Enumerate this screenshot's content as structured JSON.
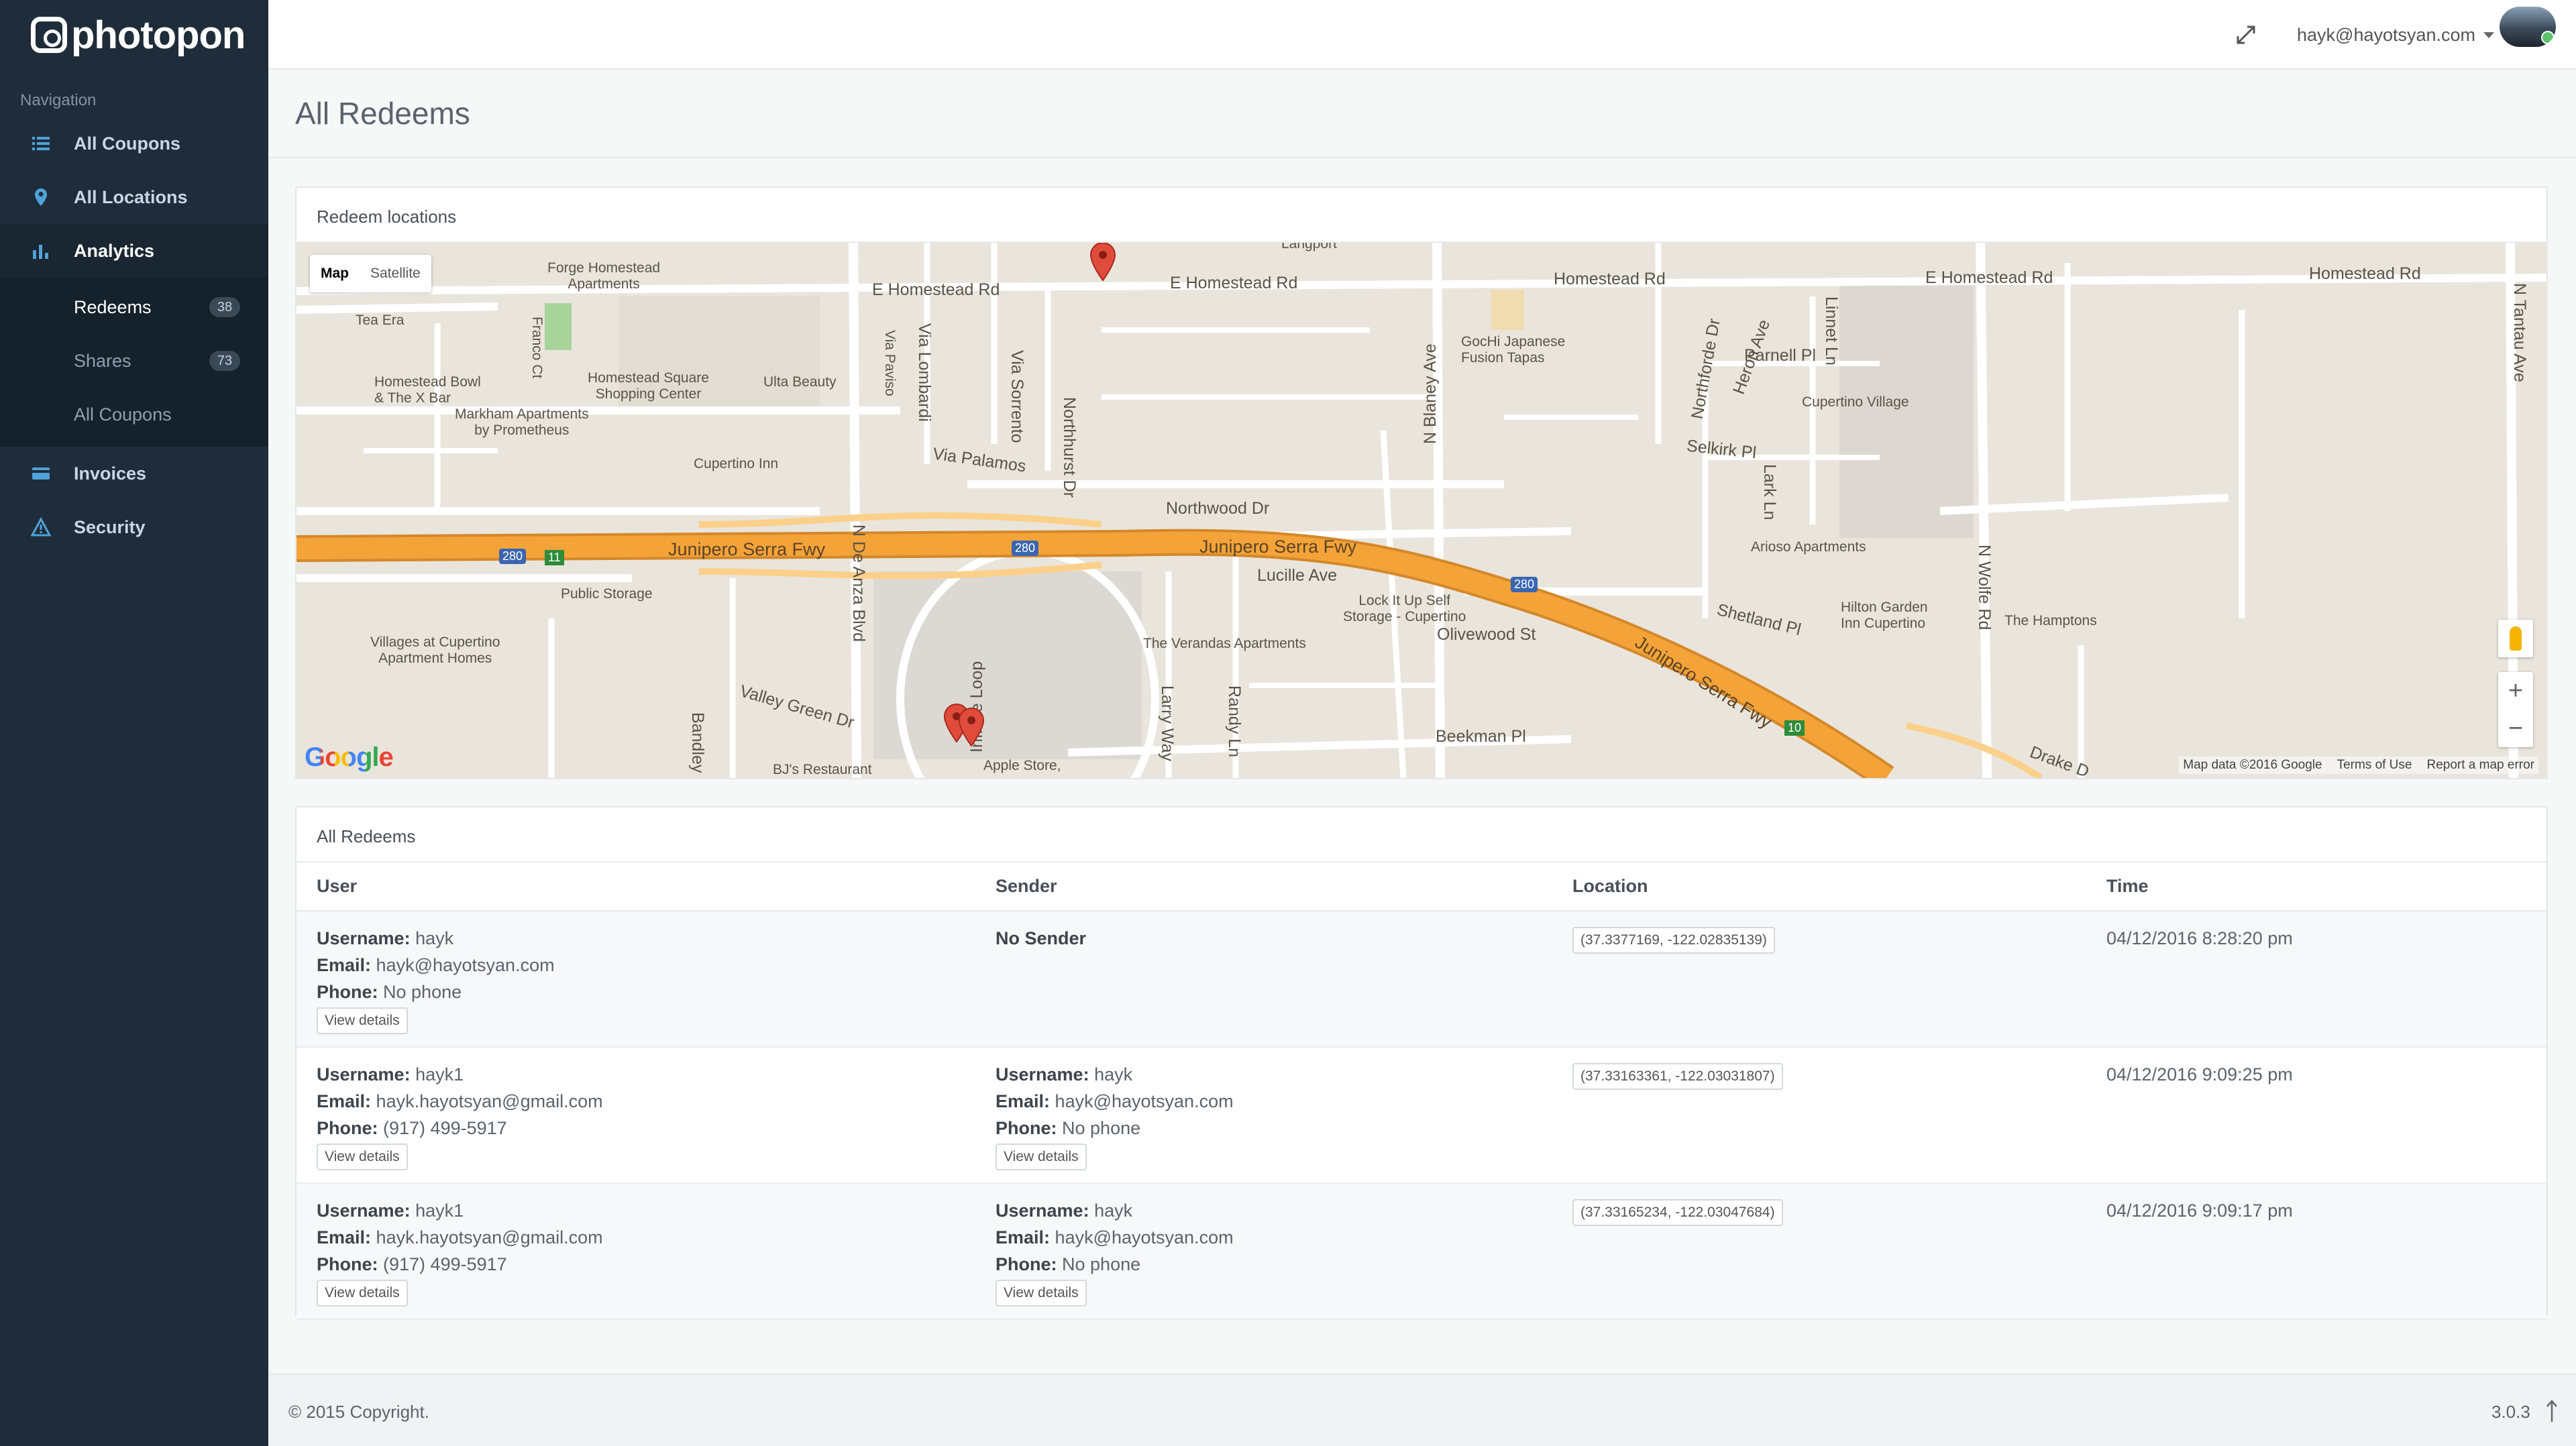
{
  "brand": {
    "name": "photopon"
  },
  "sidebar": {
    "heading": "Navigation",
    "items": [
      {
        "label": "All Coupons",
        "icon": "list-icon"
      },
      {
        "label": "All Locations",
        "icon": "map-pin-icon"
      },
      {
        "label": "Analytics",
        "icon": "bar-chart-icon",
        "active": true,
        "children": [
          {
            "label": "Redeems",
            "badge": "38",
            "active": true
          },
          {
            "label": "Shares",
            "badge": "73"
          },
          {
            "label": "All Coupons"
          }
        ]
      },
      {
        "label": "Invoices",
        "icon": "credit-card-icon"
      },
      {
        "label": "Security",
        "icon": "warning-icon"
      }
    ]
  },
  "header": {
    "user_email": "hayk@hayotsyan.com"
  },
  "page": {
    "title": "All Redeems"
  },
  "map_panel": {
    "title": "Redeem locations",
    "map_type": [
      "Map",
      "Satellite"
    ],
    "attribution": "Map data ©2016 Google",
    "terms": "Terms of Use",
    "report": "Report a map error",
    "google_logo": "Google",
    "labels": {
      "e_homestead_1": "E Homestead Rd",
      "e_homestead_2": "E Homestead Rd",
      "homestead": "Homestead Rd",
      "e_homestead_3": "E Homestead Rd",
      "homestead_4": "Homestead Rd",
      "forge": "Forge Homestead\nApartments",
      "tea_era": "Tea Era",
      "franco": "Franco Ct",
      "homestead_sq": "Homestead Square\nShopping Center",
      "ulta": "Ulta Beauty",
      "homestead_bowl": "Homestead Bowl\n& The X Bar",
      "markham": "Markham Apartments\nby Prometheus",
      "cupertino_inn": "Cupertino Inn",
      "via_palamos": "Via Palamos",
      "northwood": "Northwood Dr",
      "gochi": "GocHi Japanese\nFusion Tapas",
      "parnell": "Parnell Pl",
      "cupertino_village": "Cupertino Village",
      "selkirk": "Selkirk Pl",
      "arioso": "Arioso Apartments",
      "jsf_1": "Junipero Serra Fwy",
      "jsf_2": "Junipero Serra Fwy",
      "jsf_3": "Junipero Serra Fwy",
      "lucille": "Lucille Ave",
      "lockitup": "Lock It Up Self\nStorage - Cupertino",
      "olivewood": "Olivewood St",
      "shetland": "Shetland Pl",
      "hilton": "Hilton Garden\nInn Cupertino",
      "hamptons": "The Hamptons",
      "public_storage": "Public Storage",
      "villages": "Villages at Cupertino\nApartment Homes",
      "verandas": "The Verandas Apartments",
      "valley_green": "Valley Green Dr",
      "beekman": "Beekman Pl",
      "bjs": "BJ's Restaurant",
      "apple_store": "Apple Store,",
      "n_de_anza": "N De Anza Blvd",
      "n_blaney": "N Blaney Ave",
      "n_wolfe": "N Wolfe Rd",
      "n_tantau": "N Tantau Ave",
      "infinite_loop": "Infinite Loop",
      "larry_way": "Larry Way",
      "randy_ln": "Randy Ln",
      "bandley": "Bandley D",
      "heron": "Heron Ave",
      "linnet": "Linnet Ln",
      "lark": "Lark Ln",
      "via_lombardi": "Via Lombardi",
      "via_sorrento": "Via Sorrento",
      "northhurst": "Northhurst Dr",
      "via_paviso": "Via Paviso",
      "northforde": "Northforde Dr",
      "drake": "Drake D",
      "langport": "Langport",
      "shield_280": "280",
      "shield_11": "11",
      "shield_10": "10"
    }
  },
  "table_panel": {
    "title": "All Redeems",
    "columns": [
      "User",
      "Sender",
      "Location",
      "Time"
    ],
    "field_labels": {
      "username": "Username:",
      "email": "Email:",
      "phone": "Phone:"
    },
    "view_details": "View details",
    "rows": [
      {
        "user": {
          "username": "hayk",
          "email": "hayk@hayotsyan.com",
          "phone": "No phone"
        },
        "sender_none": "No Sender",
        "location": "(37.3377169, -122.02835139)",
        "time": "04/12/2016 8:28:20 pm"
      },
      {
        "user": {
          "username": "hayk1",
          "email": "hayk.hayotsyan@gmail.com",
          "phone": "(917) 499-5917"
        },
        "sender": {
          "username": "hayk",
          "email": "hayk@hayotsyan.com",
          "phone": "No phone"
        },
        "location": "(37.33163361, -122.03031807)",
        "time": "04/12/2016 9:09:25 pm"
      },
      {
        "user": {
          "username": "hayk1",
          "email": "hayk.hayotsyan@gmail.com",
          "phone": "(917) 499-5917"
        },
        "sender": {
          "username": "hayk",
          "email": "hayk@hayotsyan.com",
          "phone": "No phone"
        },
        "location": "(37.33165234, -122.03047684)",
        "time": "04/12/2016 9:09:17 pm"
      }
    ]
  },
  "footer": {
    "copyright": "© 2015 Copyright.",
    "version": "3.0.3"
  },
  "colors": {
    "sidebar": "#1f2d3a",
    "freeway": "#f4a339",
    "map_bg": "#e9e5dc",
    "marker": "#e04c3c"
  }
}
